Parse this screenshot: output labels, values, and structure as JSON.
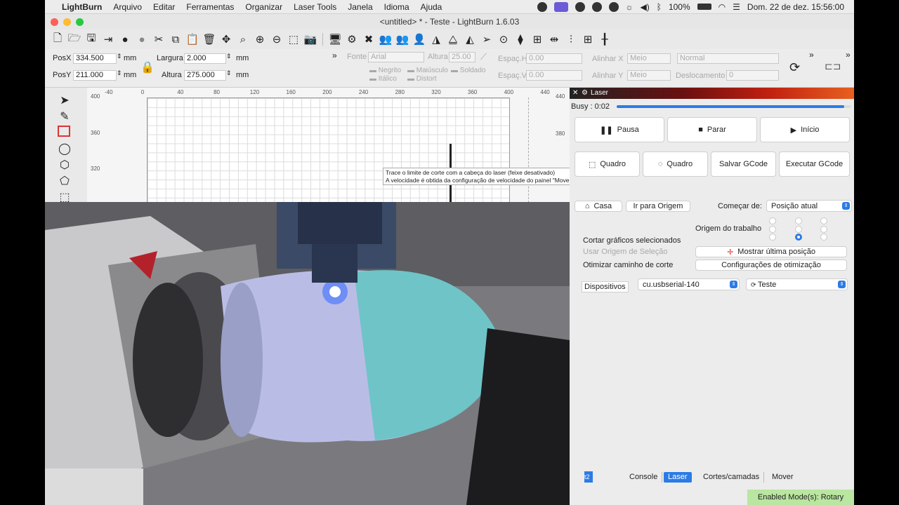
{
  "menubar": {
    "app": "LightBurn",
    "items": [
      "Arquivo",
      "Editar",
      "Ferramentas",
      "Organizar",
      "Laser Tools",
      "Janela",
      "Idioma",
      "Ajuda"
    ],
    "battery": "100%",
    "datetime": "Dom. 22 de dez.  15:56:00"
  },
  "window": {
    "title": "<untitled> * - Teste - LightBurn 1.6.03"
  },
  "numeric": {
    "posx_label": "PosX",
    "posx": "334.500",
    "posy_label": "PosY",
    "posy": "211.000",
    "unit": "mm",
    "width_label": "Largura",
    "width": "2.000",
    "height_label": "Altura",
    "height": "275.000"
  },
  "text_toolbar": {
    "font_label": "Fonte",
    "font_value": "Arial",
    "altura_label": "Altura",
    "altura_value": "25.00",
    "bold": "Negrito",
    "upper": "Maiúsculo",
    "welded": "Soldado",
    "italic": "Itálico",
    "distort": "Distort",
    "hspace_label": "Espaç.H",
    "hspace": "0.00",
    "vspace_label": "Espaç.V",
    "vspace": "0.00",
    "alignx_label": "Alinhar X",
    "alignx": "Meio",
    "aligny_label": "Alinhar Y",
    "aligny": "Meio",
    "normal": "Normal",
    "offset_label": "Deslocamento",
    "offset": "0"
  },
  "ruler": {
    "x": [
      "-40",
      "0",
      "40",
      "80",
      "120",
      "160",
      "200",
      "240",
      "280",
      "320",
      "360",
      "400",
      "440"
    ],
    "y": [
      "400",
      "360",
      "320"
    ],
    "right_y": [
      "440",
      "380"
    ]
  },
  "tooltip": {
    "line1": "Trace o limite de corte com a cabeça do laser (feixe desativado)",
    "line2": "A velocidade é obtida da configuração de velocidade do painel \"Mover\"(Alt+R)"
  },
  "laser": {
    "title": "Laser",
    "status": "Busy : 0:02",
    "progress": 0.97,
    "pause": "Pausa",
    "stop": "Parar",
    "start": "Início",
    "frame1": "Quadro",
    "frame2": "Quadro",
    "save_gcode": "Salvar GCode",
    "run_gcode": "Executar GCode",
    "home": "Casa",
    "goto_origin": "Ir para Origem",
    "start_from_label": "Começar de:",
    "start_from": "Posição atual",
    "job_origin_label": "Origem do trabalho",
    "cut_selected": "Cortar gráficos selecionados",
    "use_selection_origin": "Usar Origem de Seleção",
    "show_last_pos": "Mostrar última posição",
    "optimize_label": "Otimizar caminho de corte",
    "optimize_settings": "Configurações de otimização",
    "devices_label": "Dispositivos",
    "device": "cu.usbserial-140",
    "profile": "Teste"
  },
  "tabs": [
    "Console",
    "Laser",
    "Cortes/camadas",
    "Mover"
  ],
  "statusbar": {
    "enabled": "Enabled Mode(s): Rotary",
    "left": "t2"
  }
}
